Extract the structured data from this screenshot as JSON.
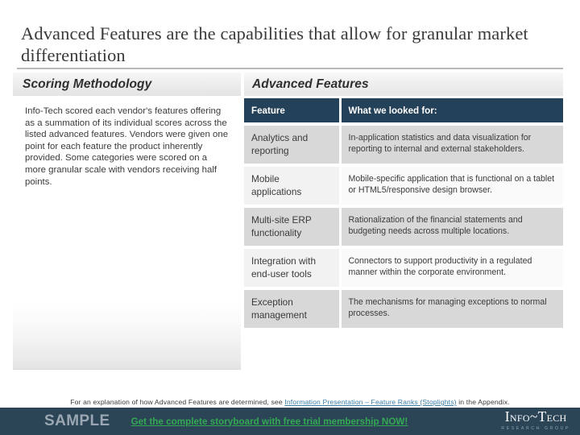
{
  "slide": {
    "title": "Advanced Features are the capabilities that allow for granular market differentiation"
  },
  "left_panel": {
    "header": "Scoring Methodology",
    "paragraph": "Info-Tech scored each vendor's features offering as a summation of its individual scores across the listed advanced features. Vendors were given one point for each feature the product inherently provided. Some categories were scored on a more granular scale with vendors receiving half points."
  },
  "right_panel": {
    "header": "Advanced Features",
    "table": {
      "columns": [
        "Feature",
        "What we looked for:"
      ],
      "rows": [
        {
          "feature": "Analytics and reporting",
          "description": "In-application statistics and data visualization for reporting to internal and external stakeholders."
        },
        {
          "feature": "Mobile applications",
          "description": "Mobile-specific application that is functional on a tablet or HTML5/responsive design browser."
        },
        {
          "feature": "Multi-site ERP functionality",
          "description": "Rationalization of the financial statements and budgeting needs across multiple locations."
        },
        {
          "feature": "Integration with end-user tools",
          "description": "Connectors to support productivity in a regulated manner within the corporate environment."
        },
        {
          "feature": "Exception management",
          "description": "The mechanisms for managing exceptions to normal processes."
        }
      ]
    }
  },
  "footnote": {
    "prefix": "For an explanation of how Advanced Features are determined, see ",
    "link": "Information Presentation – Feature Ranks (Stoplights)",
    "suffix": " in the Appendix."
  },
  "bottom_bar": {
    "sample_label": "SAMPLE",
    "promo_link": "Get the complete storyboard with free trial membership NOW!",
    "logo_main": "Info~Tech",
    "logo_sub": "RESEARCH GROUP"
  },
  "colors": {
    "table_header_bg": "#24415a",
    "bottom_bar_bg": "#2b4557",
    "promo_green": "#34a853",
    "link_blue": "#3a7ca8"
  }
}
